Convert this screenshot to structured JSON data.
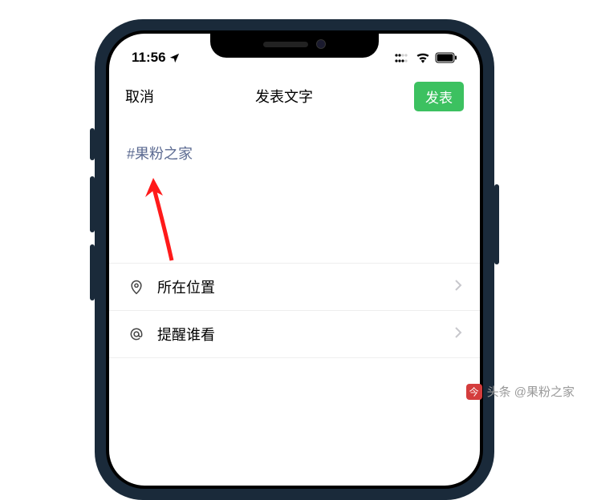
{
  "status_bar": {
    "time": "11:56"
  },
  "nav": {
    "cancel": "取消",
    "title": "发表文字",
    "publish": "发表"
  },
  "compose": {
    "hashtag": "#果粉之家"
  },
  "options": {
    "location": "所在位置",
    "mention": "提醒谁看"
  },
  "watermark": {
    "text": "头条 @果粉之家"
  }
}
